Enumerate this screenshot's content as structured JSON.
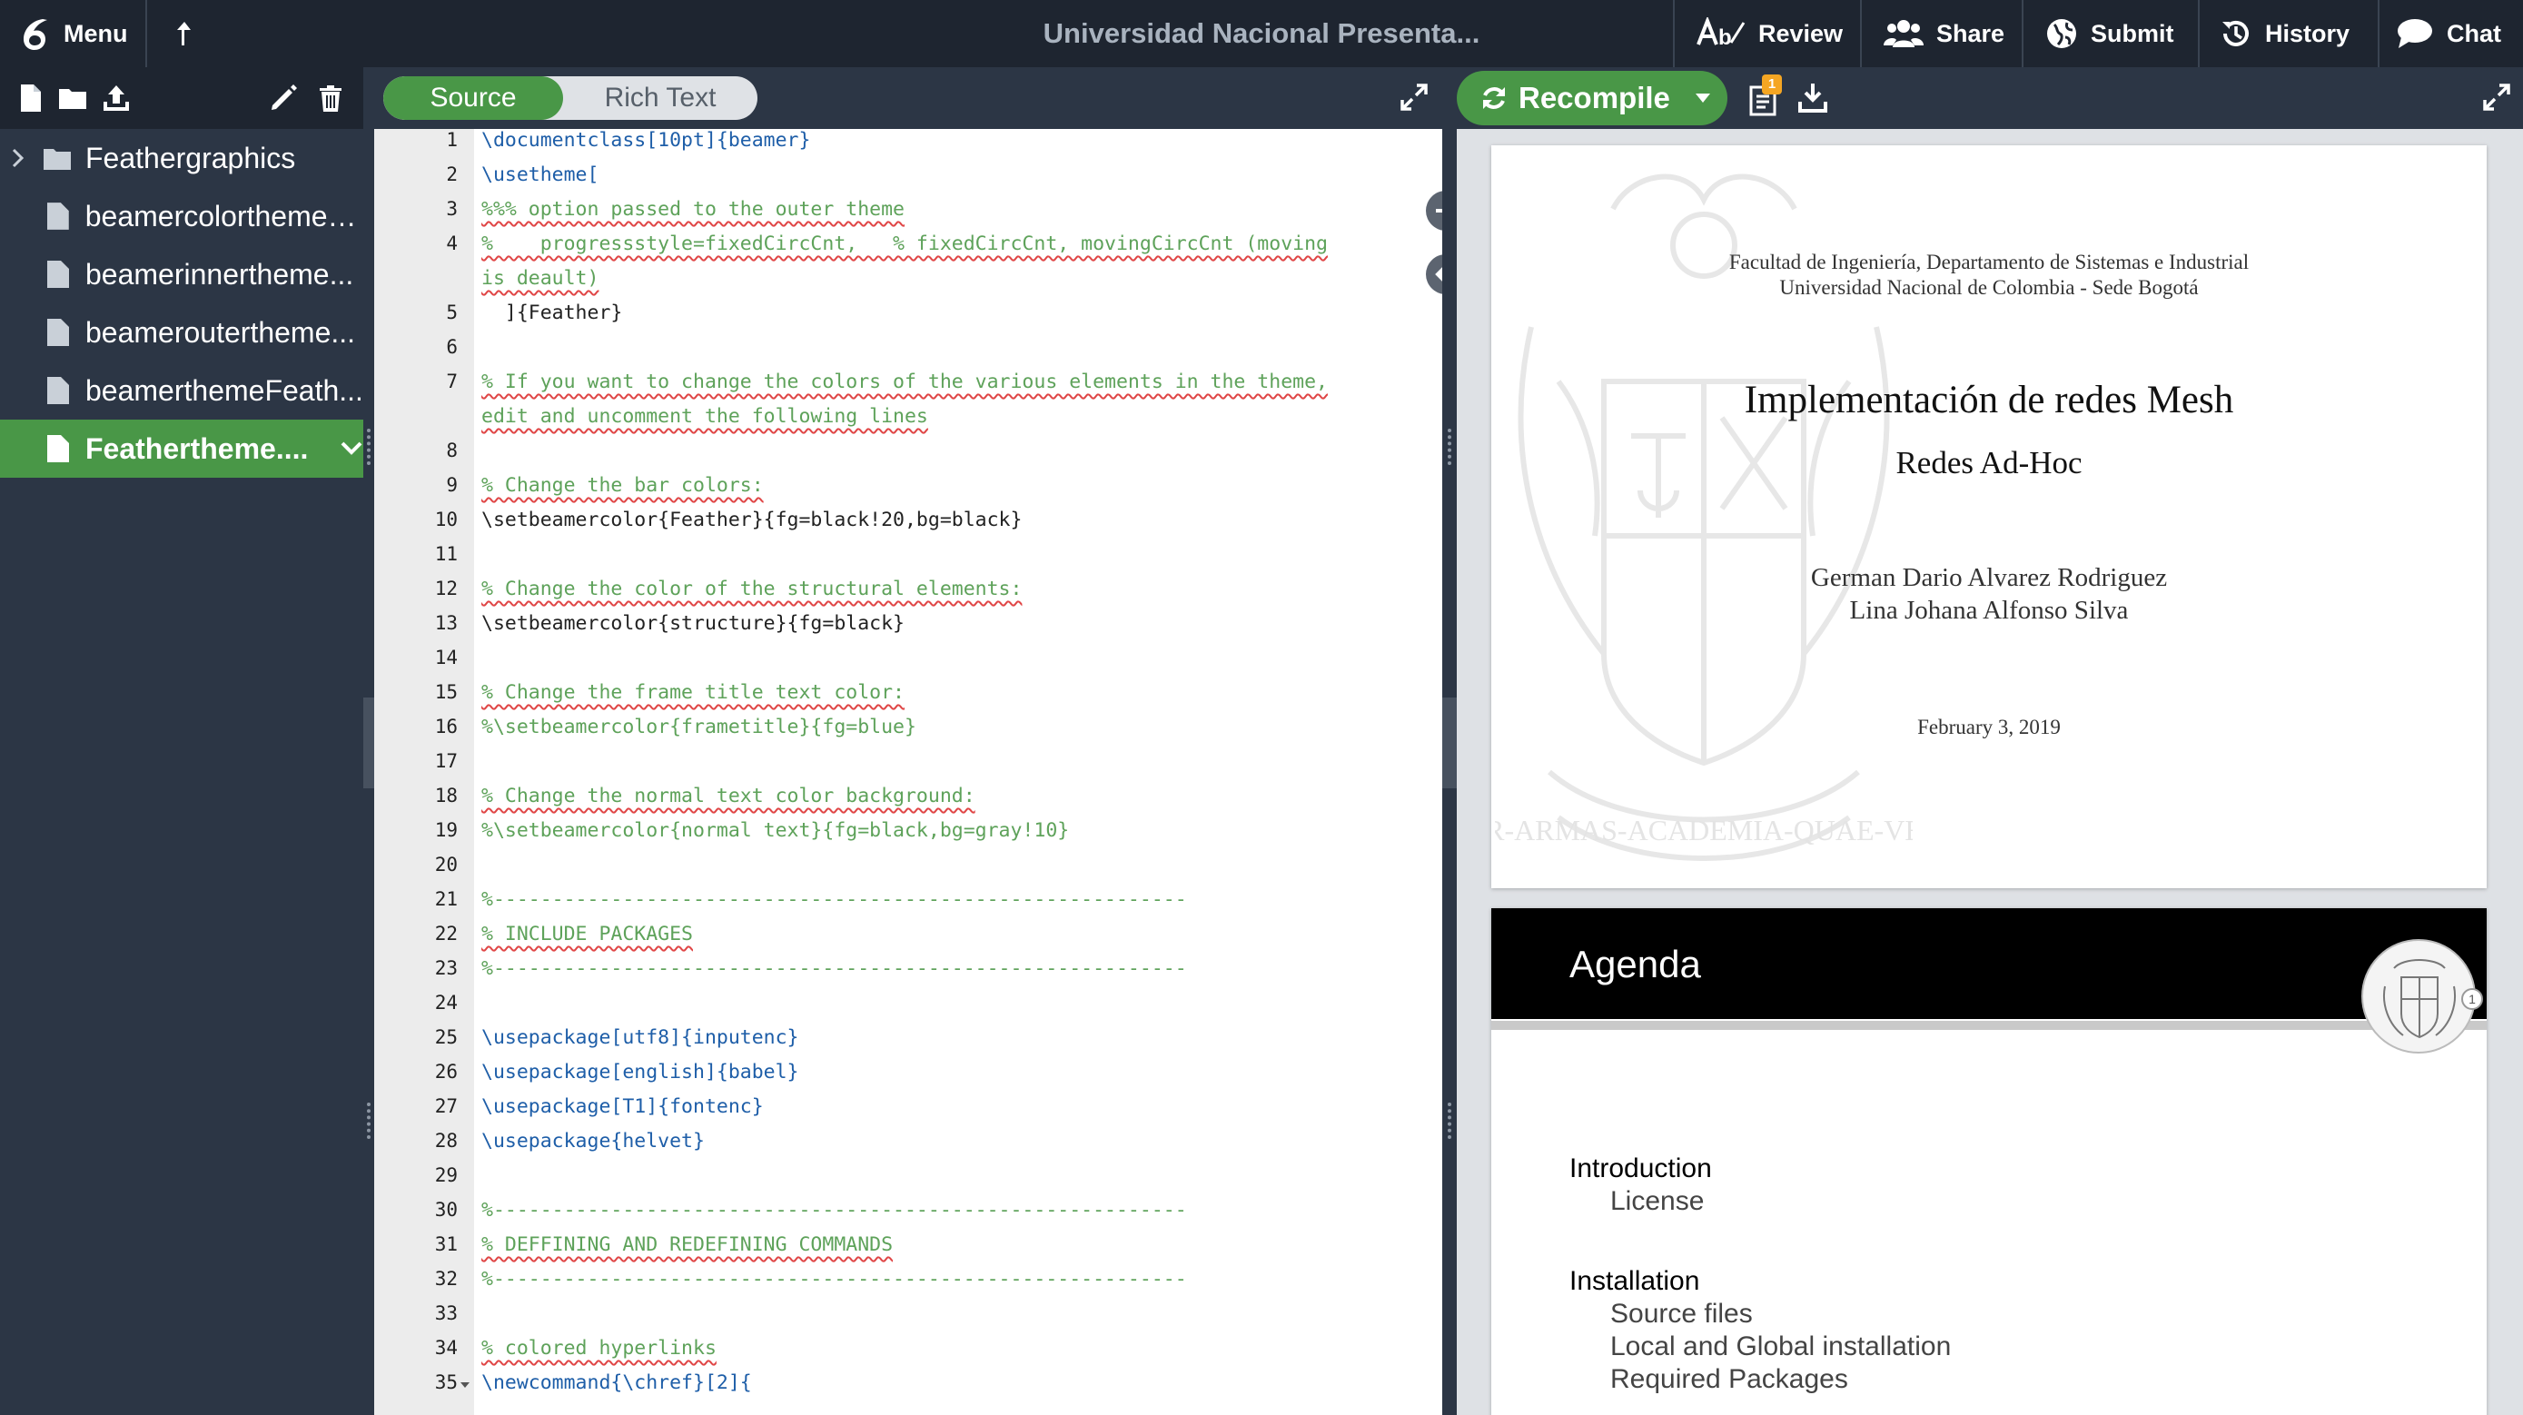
{
  "topbar": {
    "menu_label": "Menu",
    "project_title": "Universidad Nacional Presenta...",
    "review_label": "Review",
    "share_label": "Share",
    "submit_label": "Submit",
    "history_label": "History",
    "chat_label": "Chat"
  },
  "filetree": {
    "items": [
      {
        "label": "Feathergraphics",
        "type": "folder"
      },
      {
        "label": "beamercolorthemeF...",
        "type": "file"
      },
      {
        "label": "beamerinnertheme...",
        "type": "file"
      },
      {
        "label": "beameroutertheme...",
        "type": "file"
      },
      {
        "label": "beamerthemeFeath...",
        "type": "file"
      },
      {
        "label": "Feathertheme....",
        "type": "file",
        "selected": true
      }
    ]
  },
  "editor": {
    "source_label": "Source",
    "richtext_label": "Rich Text",
    "line_numbers": [
      "1",
      "2",
      "3",
      "4",
      "5",
      "6",
      "7",
      "8",
      "9",
      "10",
      "11",
      "12",
      "13",
      "14",
      "15",
      "16",
      "17",
      "18",
      "19",
      "20",
      "21",
      "22",
      "23",
      "24",
      "25",
      "26",
      "27",
      "28",
      "29",
      "30",
      "31",
      "32",
      "33",
      "34",
      "35"
    ],
    "lines": [
      "\\documentclass[10pt]{beamer}",
      "\\usetheme[",
      "%%% option passed to the outer theme",
      "%    progressstyle=fixedCircCnt,   % fixedCircCnt, movingCircCnt (moving",
      "is deault)",
      "  ]{Feather}",
      "",
      "% If you want to change the colors of the various elements in the theme,",
      "edit and uncomment the following lines",
      "",
      "% Change the bar colors:",
      "\\setbeamercolor{Feather}{fg=black!20,bg=black}",
      "",
      "% Change the color of the structural elements:",
      "\\setbeamercolor{structure}{fg=black}",
      "",
      "% Change the frame title text color:",
      "%\\setbeamercolor{frametitle}{fg=blue}",
      "",
      "% Change the normal text color background:",
      "%\\setbeamercolor{normal text}{fg=black,bg=gray!10}",
      "",
      "%-----------------------------------------------------------",
      "% INCLUDE PACKAGES",
      "%-----------------------------------------------------------",
      "",
      "\\usepackage[utf8]{inputenc}",
      "\\usepackage[english]{babel}",
      "\\usepackage[T1]{fontenc}",
      "\\usepackage{helvet}",
      "",
      "%-----------------------------------------------------------",
      "% DEFFINING AND REDEFINING COMMANDS",
      "%-----------------------------------------------------------",
      "",
      "% colored hyperlinks",
      "\\newcommand{\\chref}[2]{"
    ]
  },
  "pdf": {
    "recompile_label": "Recompile",
    "logs_badge": "1",
    "title_page": {
      "faculty": "Facultad de Ingeniería, Departamento de Sistemas e Industrial",
      "university": "Universidad Nacional de Colombia - Sede Bogotá",
      "title": "Implementación de redes Mesh",
      "subtitle": "Redes Ad-Hoc",
      "author1": "German Dario Alvarez Rodriguez",
      "author2": "Lina Johana Alfonso Silva",
      "date": "February 3, 2019",
      "seal_motto": "INTER-ARMAS-ACADEMIA-QUAE-VERUM"
    },
    "agenda_page": {
      "heading": "Agenda",
      "frame_number": "1",
      "sections": [
        {
          "title": "Introduction",
          "items": [
            "License"
          ]
        },
        {
          "title": "Installation",
          "items": [
            "Source files",
            "Local and Global installation",
            "Required Packages"
          ]
        }
      ]
    }
  }
}
